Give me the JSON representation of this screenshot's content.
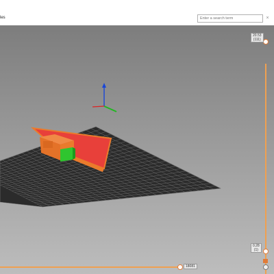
{
  "toolbar": {
    "label": "les"
  },
  "search": {
    "placeholder": "Enter a search term",
    "clear_glyph": "×"
  },
  "layer_slider": {
    "top_value": "20.53",
    "top_layer": "(111)",
    "bottom_value": "0.28",
    "bottom_layer": "(1)"
  },
  "move_slider": {
    "value": "18081"
  },
  "colors": {
    "bed_grid": "#2b2b2b",
    "grid_line": "#6a6a6a",
    "object_orange": "#ea7b2c",
    "object_red": "#e8403a",
    "object_green": "#2fc52f",
    "axis_z": "#1846d8",
    "axis_y": "#1fb81f",
    "axis_x": "#d22"
  },
  "icons": [
    "close-icon",
    "settings-icon",
    "lock-icon"
  ]
}
